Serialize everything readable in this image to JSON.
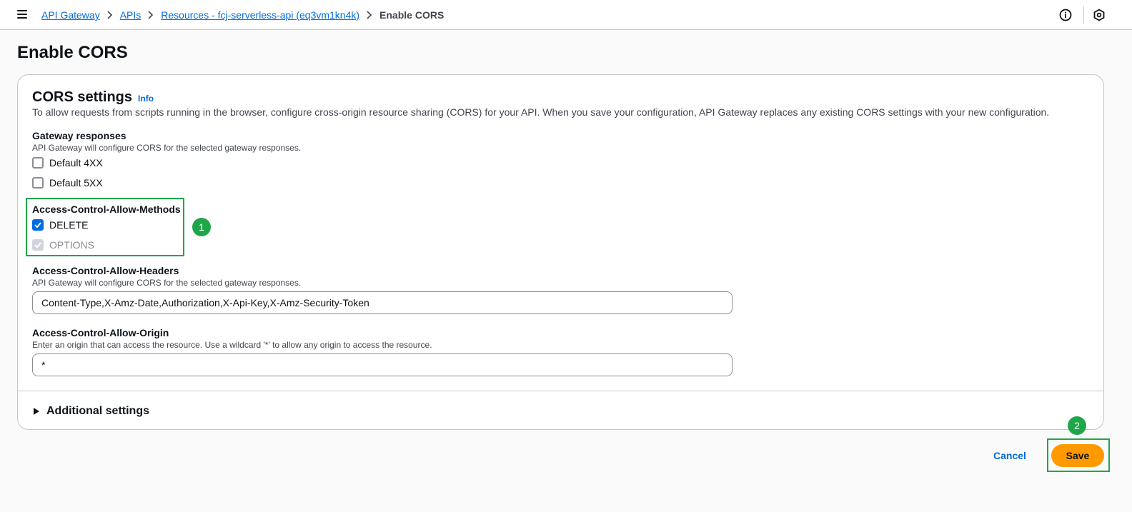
{
  "breadcrumb": {
    "items": [
      "API Gateway",
      "APIs",
      "Resources - fcj-serverless-api (eq3vm1kn4k)"
    ],
    "current": "Enable CORS"
  },
  "page": {
    "title": "Enable CORS"
  },
  "cors": {
    "heading": "CORS settings",
    "info_label": "Info",
    "description": "To allow requests from scripts running in the browser, configure cross-origin resource sharing (CORS) for your API. When you save your configuration, API Gateway replaces any existing CORS settings with your new configuration.",
    "gateway_responses": {
      "label": "Gateway responses",
      "hint": "API Gateway will configure CORS for the selected gateway responses.",
      "options": [
        {
          "label": "Default 4XX",
          "checked": false
        },
        {
          "label": "Default 5XX",
          "checked": false
        }
      ]
    },
    "allow_methods": {
      "label": "Access-Control-Allow-Methods",
      "options": [
        {
          "label": "DELETE",
          "checked": true,
          "disabled": false
        },
        {
          "label": "OPTIONS",
          "checked": true,
          "disabled": true
        }
      ]
    },
    "allow_headers": {
      "label": "Access-Control-Allow-Headers",
      "hint": "API Gateway will configure CORS for the selected gateway responses.",
      "value": "Content-Type,X-Amz-Date,Authorization,X-Api-Key,X-Amz-Security-Token"
    },
    "allow_origin": {
      "label": "Access-Control-Allow-Origin",
      "hint": "Enter an origin that can access the resource. Use a wildcard '*' to allow any origin to access the resource.",
      "value": "*"
    },
    "additional_settings": "Additional settings"
  },
  "actions": {
    "cancel": "Cancel",
    "save": "Save"
  },
  "annotations": {
    "step1": "1",
    "step2": "2"
  },
  "colors": {
    "accent": "#006ce0",
    "save": "#ff9900",
    "highlight": "#1ea84a"
  }
}
